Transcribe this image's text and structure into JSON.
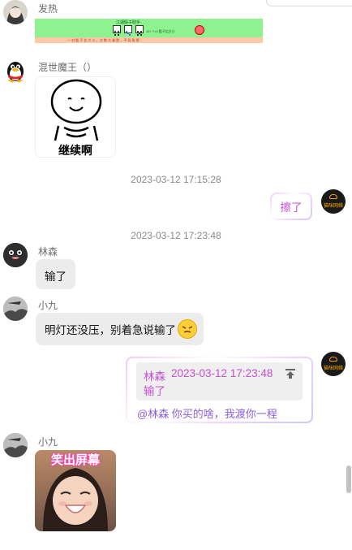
{
  "messages": {
    "m1": {
      "sender": "发热",
      "image_title": "江湖骰子助手",
      "image_subtitle": "12+ 7=0 骰子比大小",
      "image_footer": "一 对 骰 子 比 大 小 ，点 数 大 者 胜 ，平 局 再 掷"
    },
    "m2": {
      "sender": "混世魔王（）",
      "sticker_text": "继续啊"
    },
    "ts1": "2023-03-12 17:15:28",
    "m3": {
      "text": "擦了",
      "avatar_text": "猫咪网络"
    },
    "ts2": "2023-03-12 17:23:48",
    "m4": {
      "sender": "林森",
      "text": "输了"
    },
    "m5": {
      "sender": "小九",
      "text": "明灯还没压，别着急说输了"
    },
    "m6": {
      "quote_sender": "林森",
      "quote_time": "2023-03-12 17:23:48",
      "quote_text": "输了",
      "reply": "@林森 你买的啥，我渡你一程",
      "avatar_text": "猫咪网络"
    },
    "m7": {
      "sender": "小九",
      "sticker_text": "笑出屏幕"
    }
  },
  "colors": {
    "bubble_gray": "#ececec",
    "accent_text": "#c54fd1",
    "mention": "#8a5fd6"
  }
}
